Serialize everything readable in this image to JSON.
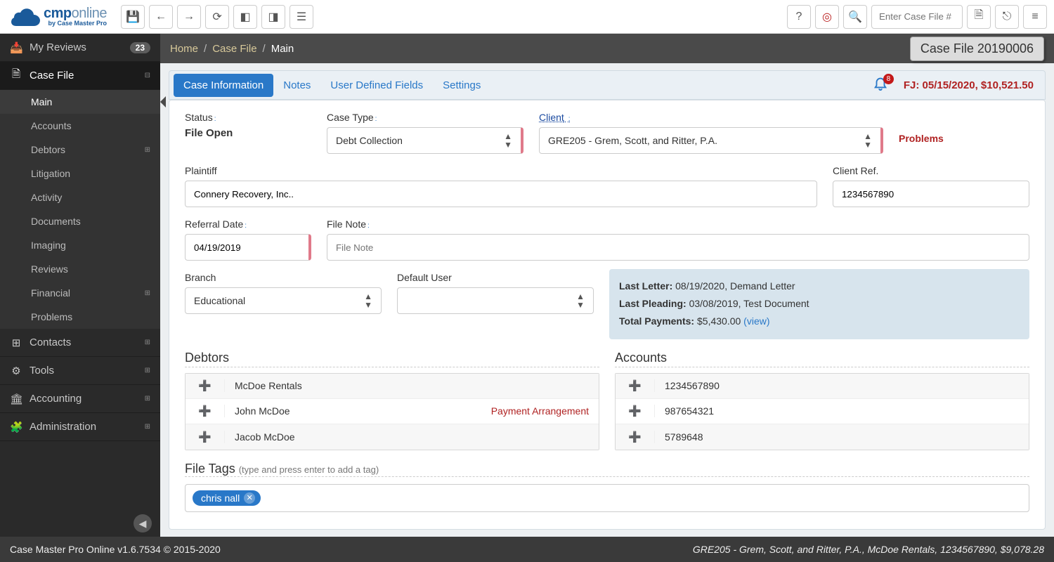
{
  "logo": {
    "brand": "cmp",
    "suffix": "online",
    "by": "by Case Master Pro"
  },
  "toolbar": {
    "search_placeholder": "Enter Case File #"
  },
  "sidebar": {
    "reviews": {
      "label": "My Reviews",
      "badge": "23"
    },
    "casefile": {
      "label": "Case File"
    },
    "subs": {
      "main": "Main",
      "accounts": "Accounts",
      "debtors": "Debtors",
      "litigation": "Litigation",
      "activity": "Activity",
      "documents": "Documents",
      "imaging": "Imaging",
      "reviews": "Reviews",
      "financial": "Financial",
      "problems": "Problems"
    },
    "contacts": "Contacts",
    "tools": "Tools",
    "accounting": "Accounting",
    "administration": "Administration"
  },
  "breadcrumb": {
    "home": "Home",
    "casefile": "Case File",
    "main": "Main"
  },
  "casefile_btn": "Case File 20190006",
  "tabs": {
    "info": "Case Information",
    "notes": "Notes",
    "udf": "User Defined Fields",
    "settings": "Settings",
    "bell_count": "8",
    "fj": "FJ: 05/15/2020, $10,521.50"
  },
  "form": {
    "status_label": "Status",
    "status_value": "File Open",
    "casetype_label": "Case Type",
    "casetype_value": "Debt Collection",
    "client_label": "Client",
    "client_value": "GRE205 - Grem, Scott, and Ritter, P.A.",
    "problems": "Problems",
    "plaintiff_label": "Plaintiff",
    "plaintiff_value": "Connery Recovery, Inc..",
    "clientref_label": "Client Ref.",
    "clientref_value": "1234567890",
    "referral_label": "Referral Date",
    "referral_value": "04/19/2019",
    "filenote_label": "File Note",
    "filenote_placeholder": "File Note",
    "branch_label": "Branch",
    "branch_value": "Educational",
    "defaultuser_label": "Default User",
    "defaultuser_value": ""
  },
  "summary": {
    "lastletter_k": "Last Letter:",
    "lastletter_v": " 08/19/2020, Demand Letter",
    "lastpleading_k": "Last Pleading:",
    "lastpleading_v": " 03/08/2019, Test Document",
    "totalpay_k": "Total Payments:",
    "totalpay_v": " $5,430.00 ",
    "view": "(view)"
  },
  "debtors": {
    "title": "Debtors",
    "rows": [
      {
        "name": "McDoe Rentals",
        "note": ""
      },
      {
        "name": "John McDoe",
        "note": "Payment Arrangement"
      },
      {
        "name": "Jacob McDoe",
        "note": ""
      }
    ]
  },
  "accounts": {
    "title": "Accounts",
    "rows": [
      {
        "name": "1234567890"
      },
      {
        "name": "987654321"
      },
      {
        "name": "5789648"
      }
    ]
  },
  "tags": {
    "title": "File Tags ",
    "hint": "(type and press enter to add a tag)",
    "items": [
      "chris nall"
    ]
  },
  "footer": {
    "left": "Case Master Pro Online v1.6.7534 © 2015-2020",
    "right": "GRE205 - Grem, Scott, and Ritter, P.A., McDoe Rentals, 1234567890, $9,078.28"
  }
}
